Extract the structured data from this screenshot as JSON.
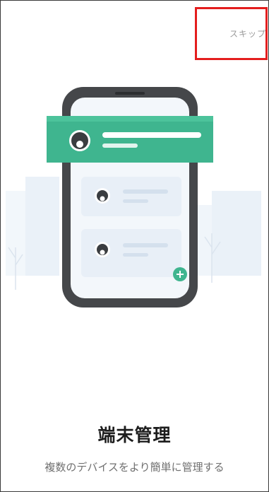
{
  "header": {
    "skip_label": "スキップ"
  },
  "onboarding": {
    "title": "端末管理",
    "subtitle": "複数のデバイスをより簡単に管理する"
  },
  "colors": {
    "accent_green": "#3fb58f",
    "highlight_red": "#e41e1e",
    "phone_frame": "#45474a"
  }
}
